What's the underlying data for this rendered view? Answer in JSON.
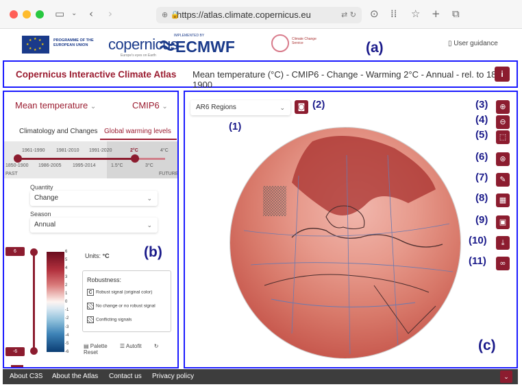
{
  "browser": {
    "url": "https://atlas.climate.copernicus.eu",
    "icons": [
      "sidebar-icon",
      "back-icon",
      "forward-icon",
      "lock-icon",
      "translate-icon",
      "reload-icon",
      "download-icon",
      "grid-icon",
      "star-icon",
      "new-tab-icon",
      "tabs-icon"
    ]
  },
  "logos": {
    "eu": "PROGRAMME OF THE EUROPEAN UNION",
    "copernicus": "opernicus",
    "copernicus_sub": "Europe's eyes on Earth",
    "ecmwf_top": "IMPLEMENTED BY",
    "ecmwf": "ECMWF",
    "c3s": "Climate Change Service",
    "guidance": "User guidance"
  },
  "header": {
    "app_title": "Copernicus Interactive Climate Atlas",
    "map_title": "Mean temperature (°C) - CMIP6 - Change - Warming 2°C - Annual - rel. to 1850-1900",
    "info": "i"
  },
  "panel": {
    "variable": "Mean temperature",
    "dataset": "CMIP6",
    "tabs": [
      "Climatology and Changes",
      "Global warming levels"
    ],
    "timeline": {
      "top_labels": [
        "1961-1990",
        "1981-2010",
        "1991-2020",
        "2°C",
        "4°C"
      ],
      "bottom_labels": [
        "1850-1900",
        "1986-2005",
        "1995-2014",
        "1.5°C",
        "3°C"
      ],
      "past": "PAST",
      "future": "FUTURE"
    },
    "quantity_label": "Quantity",
    "quantity_value": "Change",
    "season_label": "Season",
    "season_value": "Annual",
    "range_max": "6",
    "range_min": "-6",
    "colorbar_ticks": [
      "6",
      "5",
      "4",
      "3",
      "2",
      "1",
      "0",
      "-1",
      "-2",
      "-3",
      "-4",
      "-5",
      "-6"
    ],
    "units_label": "Units:",
    "units_value": "°C",
    "robustness_title": "Robustness:",
    "robustness": [
      "Robust signal (original color)",
      "No change or no robust signal",
      "Conflicting signals"
    ],
    "robust_symbol": "C",
    "actions": [
      "Palette",
      "Autofit",
      "Reset"
    ]
  },
  "map": {
    "regions": "AR6 Regions",
    "tools": [
      "zoom-in-icon",
      "zoom-out-icon",
      "fit-icon",
      "globe-icon",
      "pin-icon",
      "robustness-icon",
      "image-icon",
      "download-icon",
      "link-icon"
    ]
  },
  "callouts": {
    "a": "(a)",
    "b": "(b)",
    "c": "(c)",
    "n1": "(1)",
    "n2": "(2)",
    "n3": "(3)",
    "n4": "(4)",
    "n5": "(5)",
    "n6": "(6)",
    "n7": "(7)",
    "n8": "(8)",
    "n9": "(9)",
    "n10": "(10)",
    "n11": "(11)"
  },
  "footer": {
    "links": [
      "About C3S",
      "About the Atlas",
      "Contact us",
      "Privacy policy"
    ]
  },
  "colors": {
    "accent": "#8c1c2f",
    "annotation": "#1a1aff"
  }
}
